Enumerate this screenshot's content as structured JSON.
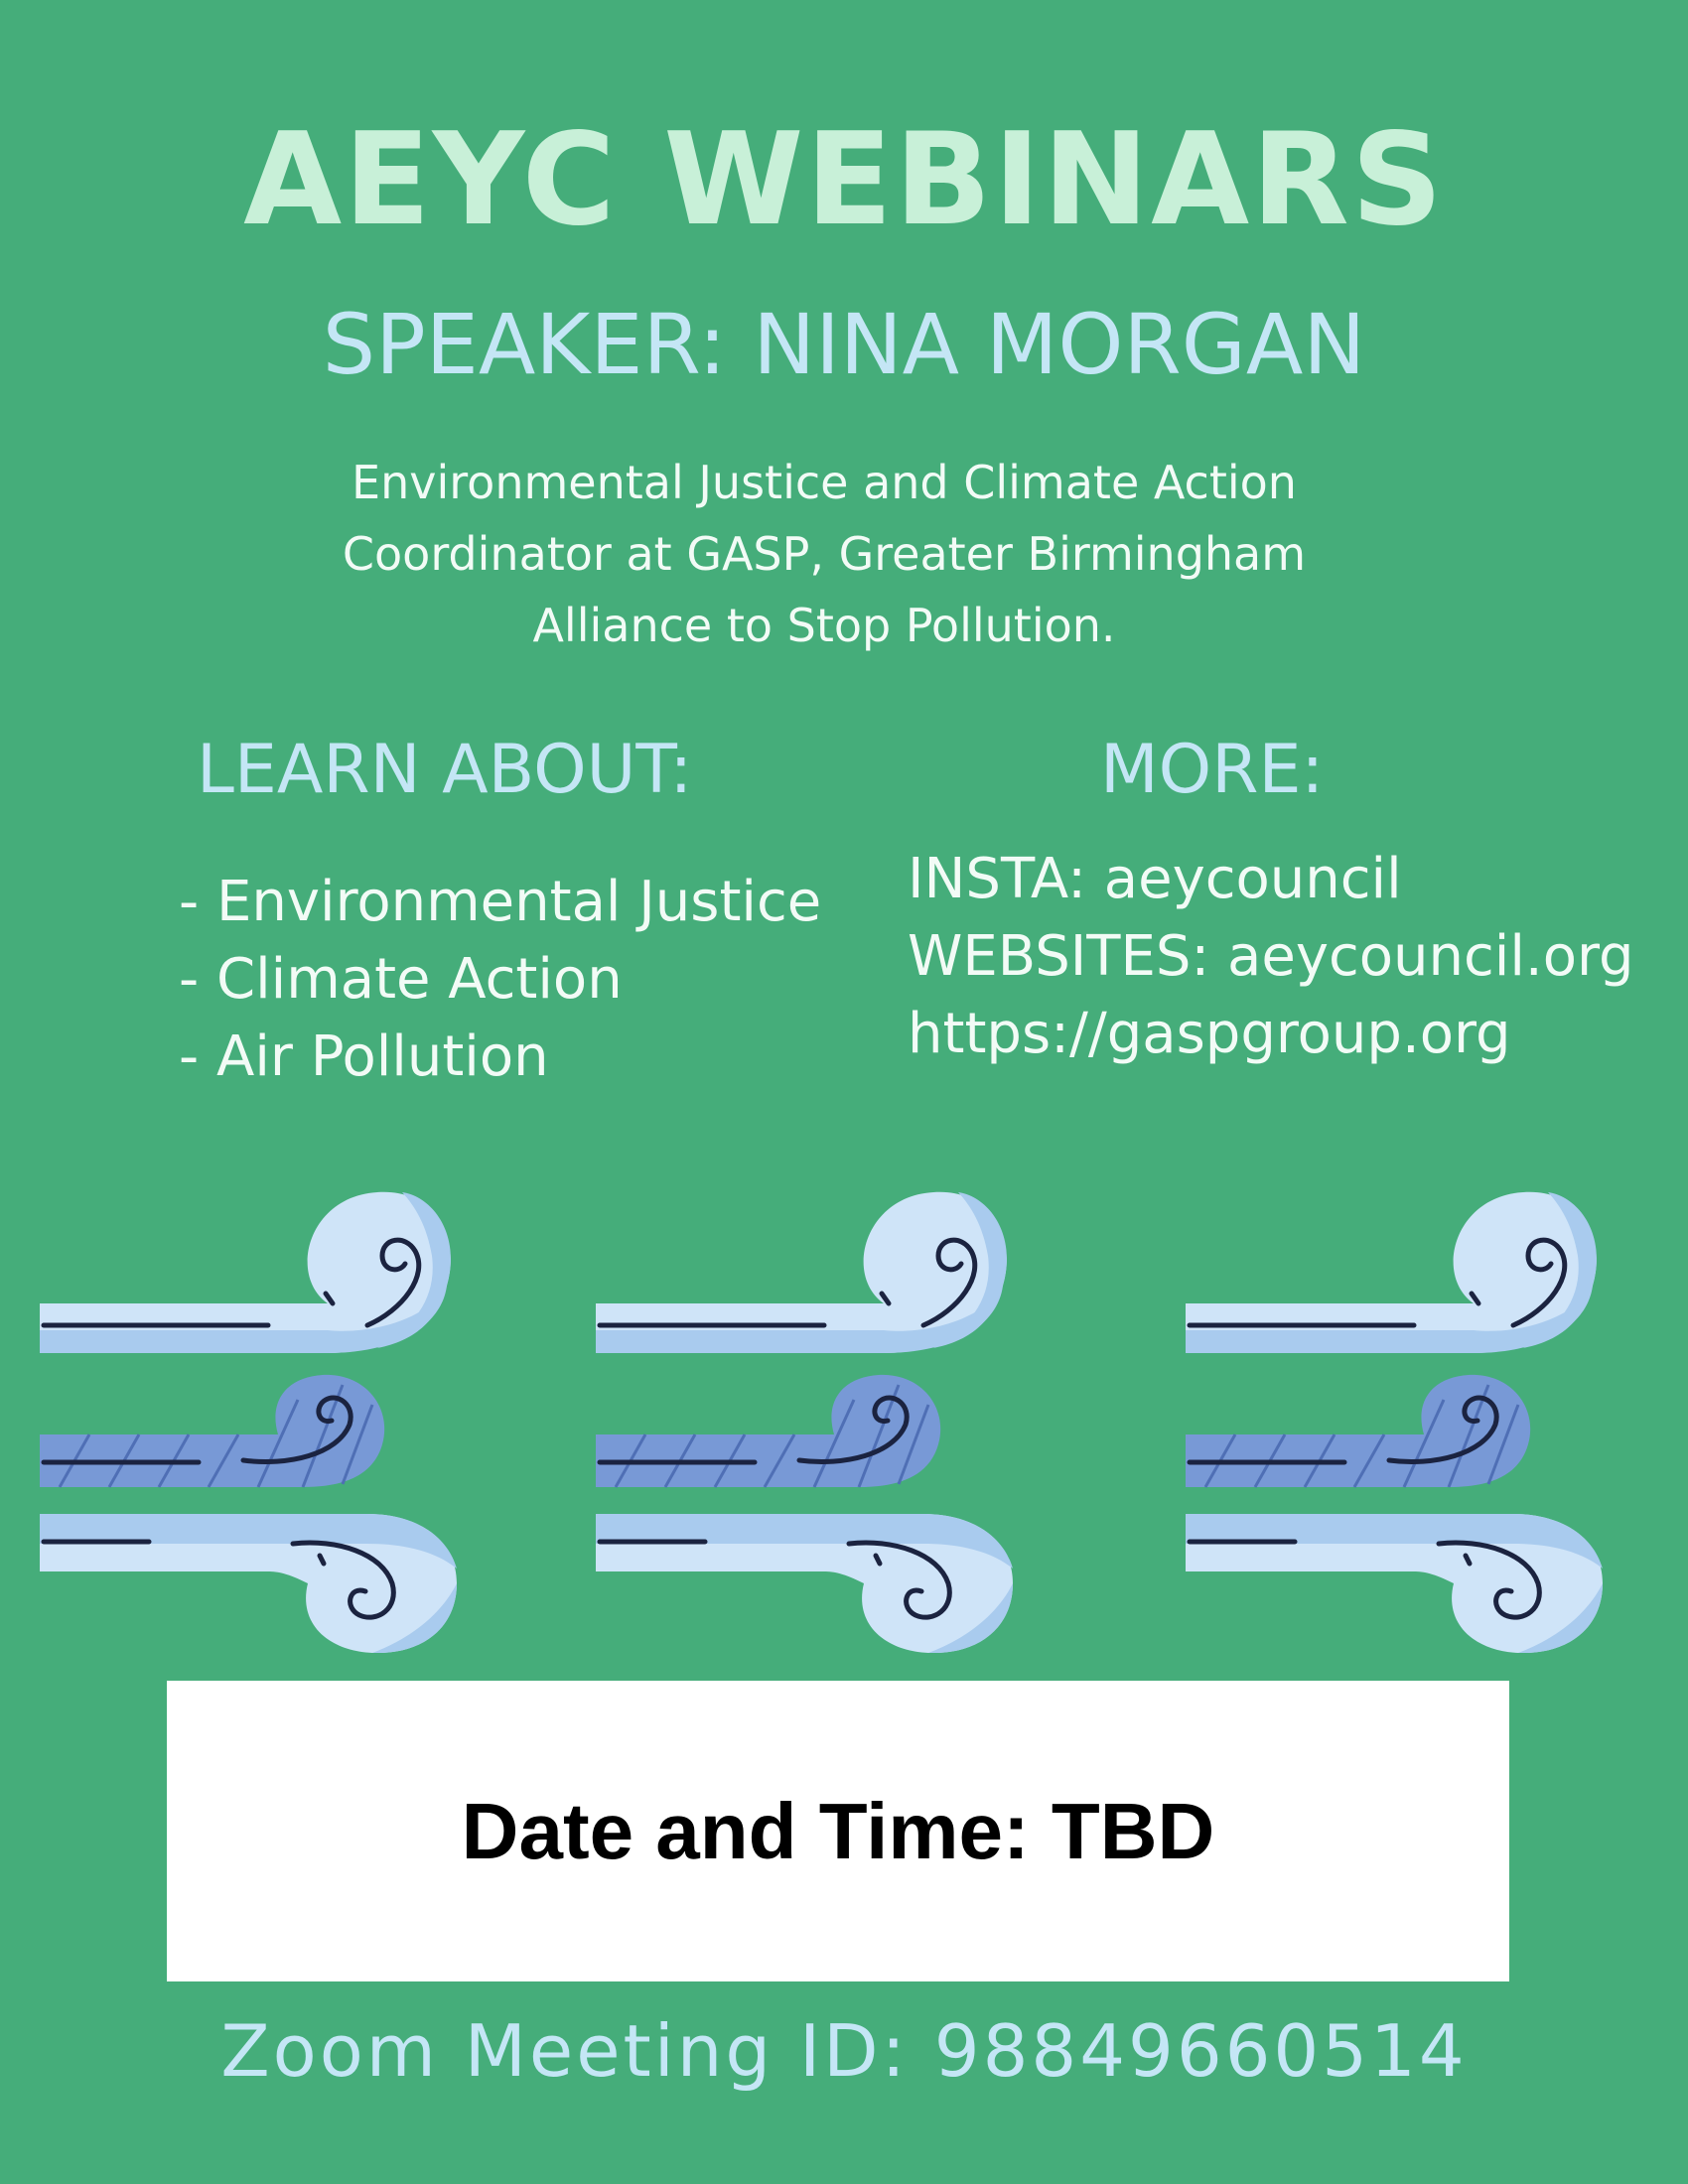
{
  "header": {
    "title": "AEYC WEBINARS",
    "speaker": "SPEAKER: NINA MORGAN"
  },
  "description": {
    "lines": [
      "Environmental Justice and Climate Action",
      "Coordinator at GASP, Greater Birmingham",
      "Alliance to Stop Pollution."
    ]
  },
  "learn": {
    "heading": "LEARN ABOUT:",
    "items": [
      "- Environmental Justice",
      "- Climate Action",
      "- Air Pollution"
    ]
  },
  "more": {
    "heading": "MORE:",
    "items": [
      "INSTA: aeycouncil",
      "WEBSITES: aeycouncil.org",
      "https://gaspgroup.org"
    ]
  },
  "illustration": {
    "icon": "wind-gust-icon",
    "count": 3,
    "colors": {
      "light_blue": "#cfe4f8",
      "mid_blue": "#a9cbee",
      "dark_blue": "#7899d6",
      "stroke": "#1b2340"
    }
  },
  "event": {
    "date_time": "Date and Time: TBD"
  },
  "footer": {
    "zoom": "Zoom Meeting ID: 98849660514"
  },
  "colors": {
    "background": "#45ad7a",
    "title": "#c8f0d8",
    "heading": "#c4e6f5",
    "body_text": "#f2fbf6",
    "box": "#ffffff"
  }
}
